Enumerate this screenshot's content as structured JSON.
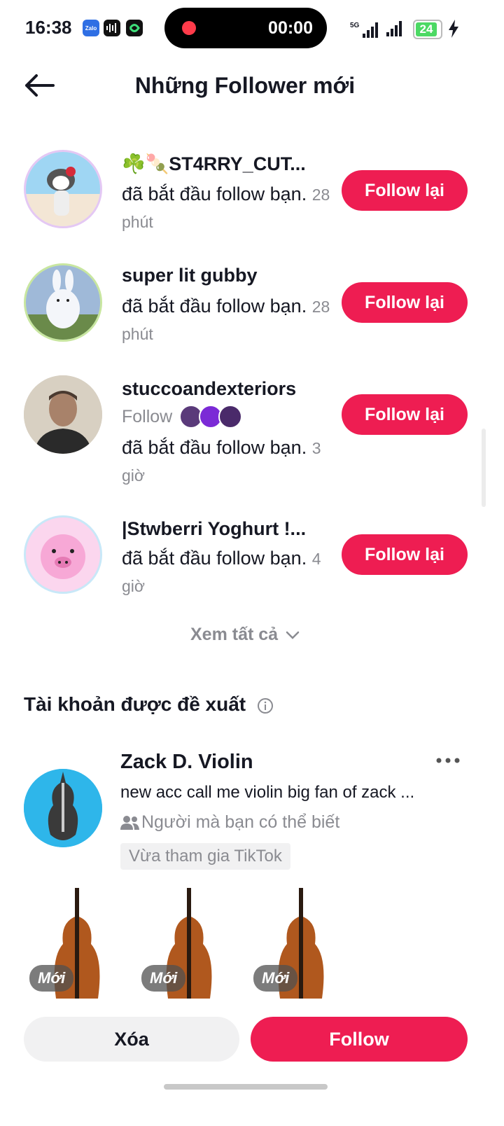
{
  "status_bar": {
    "time": "16:38",
    "record_time": "00:00",
    "network": "5G",
    "battery": "24",
    "app_icons": [
      "zalo-icon",
      "audio-icon",
      "app-icon"
    ]
  },
  "header": {
    "title": "Những Follower mới",
    "back_icon": "arrow-left-icon"
  },
  "followers": [
    {
      "username": "☘️🍡ST4RRY_CUT...",
      "desc": "đã bắt đầu follow bạn.",
      "time": "28 phút",
      "button": "Follow lại"
    },
    {
      "username": "super lit gubby",
      "desc": "đã bắt đầu follow bạn.",
      "time": "28 phút",
      "button": "Follow lại"
    },
    {
      "username": "stuccoandexteriors",
      "mutual": "Follow",
      "desc": "đã bắt đầu follow bạn.",
      "time": "3 giờ",
      "button": "Follow lại"
    },
    {
      "username": "|Stwberri Yoghurt !...",
      "desc": "đã bắt đầu follow bạn.",
      "time": "4 giờ",
      "button": "Follow lại"
    }
  ],
  "see_all": "Xem tất cả",
  "suggested": {
    "title": "Tài khoản được đề xuất",
    "account": {
      "name": "Zack D. Violin",
      "bio": "new acc call me violin big fan of zack ...",
      "reason": "Người mà bạn có thể biết",
      "tag": "Vừa tham gia TikTok",
      "thumbnails": [
        {
          "badge": "Mới"
        },
        {
          "badge": "Mới"
        },
        {
          "badge": "Mới"
        }
      ],
      "remove_label": "Xóa",
      "follow_label": "Follow"
    }
  },
  "colors": {
    "accent": "#ee1d52",
    "text": "#161823",
    "muted": "#8a8b91"
  }
}
